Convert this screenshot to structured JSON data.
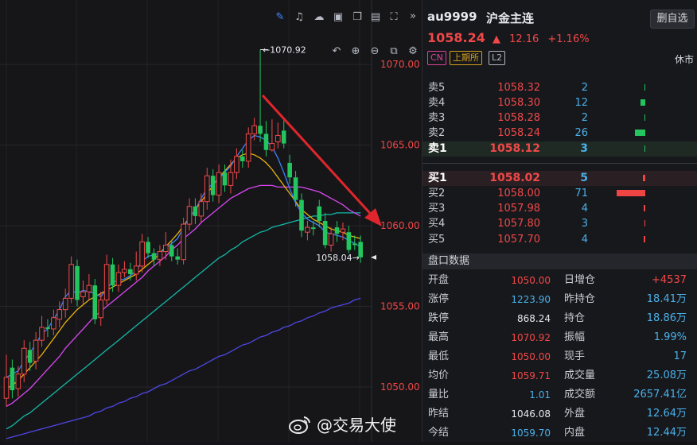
{
  "toolbar": {
    "icons_top": [
      "pen-icon",
      "bell-icon",
      "cloud-icon",
      "camera-icon",
      "copy-icon",
      "layout-icon",
      "fullscreen-icon",
      "expand-icon"
    ],
    "icons_second": [
      "undo-icon",
      "zoom-in-icon",
      "zoom-out-icon",
      "crop-icon",
      "settings-icon"
    ]
  },
  "chart": {
    "price_axis": [
      "1070.00",
      "1065.00",
      "1060.00",
      "1055.00",
      "1050.00"
    ],
    "high_label": "1070.92",
    "last_label": "1058.04",
    "colors": {
      "up": "#f04848",
      "down": "#22c55e",
      "ma5": "#3b82f6",
      "ma10": "#eab308",
      "ma20": "#d946ef",
      "ma30": "#14b8a6",
      "ma60": "#4f46e5"
    }
  },
  "chart_data": {
    "type": "candlestick",
    "ylim": [
      1046.6,
      1074.0
    ],
    "candles": [
      [
        1049.3,
        1050.6,
        1048.8,
        1052.0
      ],
      [
        1051.2,
        1049.8,
        1049.3,
        1051.7
      ],
      [
        1049.9,
        1050.8,
        1049.4,
        1051.3
      ],
      [
        1050.8,
        1052.4,
        1050.3,
        1052.9
      ],
      [
        1052.3,
        1051.5,
        1051.0,
        1052.8
      ],
      [
        1051.6,
        1052.9,
        1051.1,
        1053.4
      ],
      [
        1052.9,
        1053.7,
        1052.5,
        1054.4
      ],
      [
        1053.7,
        1053.6,
        1053.1,
        1054.2
      ],
      [
        1053.6,
        1054.3,
        1053.2,
        1054.8
      ],
      [
        1054.2,
        1054.8,
        1053.7,
        1055.3
      ],
      [
        1054.8,
        1055.5,
        1054.3,
        1056.1
      ],
      [
        1055.5,
        1057.6,
        1055.2,
        1058.1
      ],
      [
        1057.5,
        1055.4,
        1055.0,
        1057.9
      ],
      [
        1055.6,
        1055.9,
        1055.1,
        1056.6
      ],
      [
        1055.9,
        1056.3,
        1055.4,
        1057.0
      ],
      [
        1056.3,
        1054.2,
        1053.9,
        1056.7
      ],
      [
        1054.3,
        1055.4,
        1053.8,
        1055.9
      ],
      [
        1055.4,
        1057.6,
        1055.1,
        1058.2
      ],
      [
        1057.6,
        1056.3,
        1055.9,
        1058.0
      ],
      [
        1056.3,
        1057.1,
        1055.9,
        1057.6
      ],
      [
        1057.1,
        1057.3,
        1056.8,
        1057.8
      ],
      [
        1057.3,
        1057.0,
        1056.6,
        1057.7
      ],
      [
        1057.0,
        1057.5,
        1056.6,
        1058.4
      ],
      [
        1057.5,
        1059.0,
        1057.1,
        1059.5
      ],
      [
        1059.0,
        1058.3,
        1058.0,
        1059.3
      ],
      [
        1058.3,
        1057.9,
        1057.5,
        1058.6
      ],
      [
        1057.9,
        1058.4,
        1057.5,
        1058.8
      ],
      [
        1058.4,
        1058.8,
        1057.9,
        1059.6
      ],
      [
        1058.8,
        1058.1,
        1057.8,
        1059.1
      ],
      [
        1058.1,
        1057.9,
        1057.6,
        1058.6
      ],
      [
        1057.9,
        1060.1,
        1057.6,
        1060.5
      ],
      [
        1060.1,
        1061.2,
        1059.7,
        1061.7
      ],
      [
        1061.2,
        1060.6,
        1060.1,
        1061.7
      ],
      [
        1060.6,
        1061.5,
        1060.2,
        1062.0
      ],
      [
        1061.5,
        1063.1,
        1061.0,
        1063.6
      ],
      [
        1063.1,
        1061.9,
        1061.5,
        1063.5
      ],
      [
        1061.9,
        1063.3,
        1061.4,
        1063.8
      ],
      [
        1063.3,
        1062.5,
        1062.1,
        1063.8
      ],
      [
        1062.5,
        1063.3,
        1062.0,
        1064.1
      ],
      [
        1063.3,
        1064.3,
        1062.9,
        1064.8
      ],
      [
        1064.3,
        1064.0,
        1063.6,
        1064.7
      ],
      [
        1064.0,
        1065.7,
        1063.6,
        1066.1
      ],
      [
        1065.7,
        1066.2,
        1065.3,
        1066.7
      ],
      [
        1066.2,
        1065.7,
        1065.2,
        1070.92
      ],
      [
        1065.7,
        1064.7,
        1064.3,
        1066.5
      ],
      [
        1064.7,
        1065.1,
        1064.6,
        1066.6
      ],
      [
        1065.2,
        1065.6,
        1064.8,
        1066.4
      ],
      [
        1065.9,
        1065.1,
        1064.8,
        1066.7
      ],
      [
        1063.9,
        1063.0,
        1062.6,
        1064.4
      ],
      [
        1063.0,
        1061.6,
        1061.2,
        1063.4
      ],
      [
        1061.6,
        1059.7,
        1059.3,
        1062.0
      ],
      [
        1059.6,
        1059.9,
        1059.1,
        1060.3
      ],
      [
        1059.9,
        1059.8,
        1059.4,
        1060.3
      ],
      [
        1061.2,
        1060.3,
        1059.9,
        1061.6
      ],
      [
        1060.3,
        1058.8,
        1058.6,
        1060.8
      ],
      [
        1058.8,
        1059.5,
        1058.4,
        1059.9
      ],
      [
        1059.9,
        1059.5,
        1059.0,
        1060.3
      ],
      [
        1059.6,
        1059.8,
        1059.1,
        1060.2
      ],
      [
        1059.6,
        1058.5,
        1058.3,
        1060.0
      ],
      [
        1058.9,
        1058.8,
        1058.5,
        1059.4
      ],
      [
        1059.0,
        1058.04,
        1057.7,
        1059.4
      ]
    ],
    "ma5": [
      1050.6,
      1050.8,
      1051.0,
      1051.6,
      1052.1,
      1052.7,
      1053.3,
      1053.6,
      1054.2,
      1054.8,
      1055.6,
      1056.0,
      1055.8,
      1056.0,
      1055.9,
      1055.8,
      1055.6,
      1056.1,
      1056.5,
      1056.6,
      1056.7,
      1056.9,
      1057.2,
      1057.8,
      1058.1,
      1058.2,
      1058.3,
      1058.6,
      1058.9,
      1059.2,
      1059.9,
      1060.5,
      1061.0,
      1061.7,
      1062.3,
      1062.6,
      1062.9,
      1063.3,
      1063.7,
      1064.3,
      1064.8,
      1065.3,
      1065.6,
      1065.5,
      1065.3,
      1064.9,
      1064.2,
      1063.3,
      1062.3,
      1061.4,
      1060.8,
      1060.4,
      1060.2,
      1060.0,
      1059.6,
      1059.5,
      1059.4,
      1059.3,
      1059.1,
      1058.9,
      1058.7
    ],
    "ma10": [
      1049.9,
      1050.1,
      1050.4,
      1050.8,
      1051.2,
      1051.6,
      1052.0,
      1052.5,
      1053.0,
      1053.5,
      1054.0,
      1054.4,
      1054.8,
      1055.1,
      1055.4,
      1055.6,
      1055.8,
      1056.0,
      1056.2,
      1056.4,
      1056.6,
      1056.8,
      1057.0,
      1057.3,
      1057.6,
      1057.9,
      1058.3,
      1058.7,
      1059.1,
      1059.5,
      1060.0,
      1060.5,
      1061.0,
      1061.5,
      1062.0,
      1062.5,
      1063.0,
      1063.4,
      1063.8,
      1064.2,
      1064.4,
      1064.5,
      1064.4,
      1064.2,
      1063.9,
      1063.5,
      1063.0,
      1062.5,
      1062.0,
      1061.5,
      1061.0,
      1060.7,
      1060.4,
      1060.2,
      1060.0,
      1059.8,
      1059.7,
      1059.6,
      1059.4,
      1059.3,
      1059.2
    ],
    "ma20": [
      1048.8,
      1049.0,
      1049.3,
      1049.6,
      1049.9,
      1050.3,
      1050.7,
      1051.1,
      1051.5,
      1051.9,
      1052.4,
      1052.8,
      1053.2,
      1053.6,
      1054.0,
      1054.4,
      1054.7,
      1055.0,
      1055.3,
      1055.6,
      1055.9,
      1056.2,
      1056.5,
      1056.8,
      1057.2,
      1057.5,
      1057.8,
      1058.1,
      1058.5,
      1058.8,
      1059.2,
      1059.5,
      1059.8,
      1060.2,
      1060.5,
      1060.8,
      1061.1,
      1061.4,
      1061.7,
      1061.9,
      1062.1,
      1062.3,
      1062.4,
      1062.5,
      1062.5,
      1062.5,
      1062.4,
      1062.4,
      1062.4,
      1062.4,
      1062.4,
      1062.3,
      1062.2,
      1062.1,
      1061.9,
      1061.7,
      1061.5,
      1061.3,
      1061.0,
      1060.8,
      1060.6
    ],
    "ma30": [
      1047.4,
      1047.6,
      1047.9,
      1048.2,
      1048.4,
      1048.7,
      1049.0,
      1049.3,
      1049.6,
      1049.9,
      1050.2,
      1050.5,
      1050.8,
      1051.1,
      1051.4,
      1051.7,
      1052.0,
      1052.3,
      1052.6,
      1052.9,
      1053.2,
      1053.5,
      1053.8,
      1054.1,
      1054.4,
      1054.7,
      1055.0,
      1055.3,
      1055.6,
      1055.9,
      1056.2,
      1056.5,
      1056.8,
      1057.1,
      1057.4,
      1057.7,
      1058.0,
      1058.2,
      1058.5,
      1058.7,
      1059.0,
      1059.2,
      1059.4,
      1059.6,
      1059.7,
      1059.9,
      1060.0,
      1060.1,
      1060.2,
      1060.3,
      1060.4,
      1060.5,
      1060.6,
      1060.6,
      1060.7,
      1060.7,
      1060.8,
      1060.8,
      1060.8,
      1060.8,
      1060.8
    ],
    "ma60": [
      1046.8,
      1046.9,
      1047.0,
      1047.1,
      1047.2,
      1047.3,
      1047.4,
      1047.5,
      1047.6,
      1047.7,
      1047.8,
      1047.9,
      1048.0,
      1048.1,
      1048.2,
      1048.4,
      1048.5,
      1048.7,
      1048.8,
      1049.0,
      1049.1,
      1049.3,
      1049.4,
      1049.6,
      1049.7,
      1049.9,
      1050.1,
      1050.2,
      1050.4,
      1050.6,
      1050.8,
      1051.0,
      1051.1,
      1051.3,
      1051.5,
      1051.7,
      1051.9,
      1052.0,
      1052.2,
      1052.4,
      1052.6,
      1052.7,
      1052.9,
      1053.1,
      1053.2,
      1053.4,
      1053.5,
      1053.7,
      1053.8,
      1054.0,
      1054.1,
      1054.3,
      1054.4,
      1054.6,
      1054.7,
      1054.9,
      1055.0,
      1055.1,
      1055.2,
      1055.4,
      1055.5
    ]
  },
  "quote": {
    "code": "au9999",
    "name": "沪金主连",
    "watch_label": "删自选",
    "last": "1058.24",
    "change": "12.16",
    "change_pct": "+1.16%",
    "tags": [
      {
        "label": "CN",
        "color": "#e0409b"
      },
      {
        "label": "上期所",
        "color": "#d6a21c"
      },
      {
        "label": "L2",
        "color": "#b2b6c0"
      }
    ],
    "status": "休市"
  },
  "orderbook": {
    "asks": [
      {
        "label": "卖5",
        "price": "1058.32",
        "vol": "2",
        "bar": 0.03
      },
      {
        "label": "卖4",
        "price": "1058.30",
        "vol": "12",
        "bar": 0.17
      },
      {
        "label": "卖3",
        "price": "1058.28",
        "vol": "2",
        "bar": 0.03
      },
      {
        "label": "卖2",
        "price": "1058.24",
        "vol": "26",
        "bar": 0.37
      },
      {
        "label": "卖1",
        "price": "1058.12",
        "vol": "3",
        "bar": 0.04
      }
    ],
    "bids": [
      {
        "label": "买1",
        "price": "1058.02",
        "vol": "5",
        "bar": 0.07
      },
      {
        "label": "买2",
        "price": "1058.00",
        "vol": "71",
        "bar": 1.0
      },
      {
        "label": "买3",
        "price": "1057.98",
        "vol": "4",
        "bar": 0.06
      },
      {
        "label": "买4",
        "price": "1057.80",
        "vol": "3",
        "bar": 0.04
      },
      {
        "label": "买5",
        "price": "1057.70",
        "vol": "4",
        "bar": 0.06
      }
    ]
  },
  "stats": {
    "title": "盘口数据",
    "rows": [
      {
        "l1": "开盘",
        "v1": "1050.00",
        "c1": "red",
        "l2": "日增仓",
        "v2": "+4537",
        "c2": "red"
      },
      {
        "l1": "涨停",
        "v1": "1223.90",
        "c1": "cyan",
        "l2": "昨持仓",
        "v2": "18.41万",
        "c2": "cyan"
      },
      {
        "l1": "跌停",
        "v1": "868.24",
        "c1": "white",
        "l2": "持仓",
        "v2": "18.86万",
        "c2": "cyan"
      },
      {
        "l1": "最高",
        "v1": "1070.92",
        "c1": "red",
        "l2": "振幅",
        "v2": "1.99%",
        "c2": "cyan"
      },
      {
        "l1": "最低",
        "v1": "1050.00",
        "c1": "red",
        "l2": "现手",
        "v2": "17",
        "c2": "cyan"
      },
      {
        "l1": "均价",
        "v1": "1059.71",
        "c1": "red",
        "l2": "成交量",
        "v2": "25.08万",
        "c2": "cyan"
      },
      {
        "l1": "量比",
        "v1": "1.01",
        "c1": "cyan",
        "l2": "成交额",
        "v2": "2657.41亿",
        "c2": "cyan"
      },
      {
        "l1": "昨结",
        "v1": "1046.08",
        "c1": "white",
        "l2": "外盘",
        "v2": "12.64万",
        "c2": "cyan"
      },
      {
        "l1": "今结",
        "v1": "1059.70",
        "c1": "cyan",
        "l2": "内盘",
        "v2": "12.44万",
        "c2": "cyan"
      }
    ]
  },
  "watermark": "@交易大使"
}
